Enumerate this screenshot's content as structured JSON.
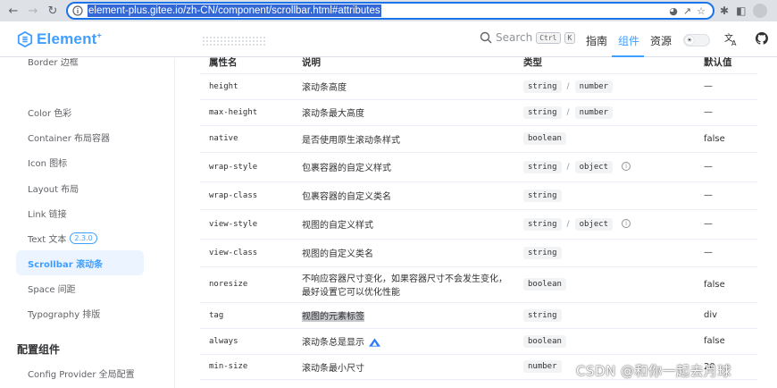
{
  "browser": {
    "url": "element-plus.gitee.io/zh-CN/component/scrollbar.html#attributes"
  },
  "header": {
    "logo_text": "Element",
    "logo_sup": "+",
    "search_label": "Search",
    "search_keys": [
      "Ctrl",
      "K"
    ],
    "nav": [
      "指南",
      "组件",
      "资源"
    ],
    "active_nav": "组件"
  },
  "sidebar": {
    "cut_item": "Border 边框",
    "items": [
      {
        "label": "Color 色彩"
      },
      {
        "label": "Container 布局容器"
      },
      {
        "label": "Icon 图标"
      },
      {
        "label": "Layout 布局"
      },
      {
        "label": "Link 链接"
      },
      {
        "label": "Text 文本",
        "badge": "2.3.0"
      },
      {
        "label": "Scrollbar 滚动条",
        "active": true
      },
      {
        "label": "Space 间距"
      },
      {
        "label": "Typography 排版"
      }
    ],
    "group_title": "配置组件",
    "group_items": [
      {
        "label": "Config Provider 全局配置"
      }
    ]
  },
  "table": {
    "headers": [
      "属性名",
      "说明",
      "类型",
      "默认值"
    ],
    "rows": [
      {
        "name": "height",
        "desc": "滚动条高度",
        "types": [
          "string",
          "number"
        ],
        "info": false,
        "default": "—"
      },
      {
        "name": "max-height",
        "desc": "滚动条最大高度",
        "types": [
          "string",
          "number"
        ],
        "info": false,
        "default": "—"
      },
      {
        "name": "native",
        "desc": "是否使用原生滚动条样式",
        "types": [
          "boolean"
        ],
        "info": false,
        "default": "false"
      },
      {
        "name": "wrap-style",
        "desc": "包裹容器的自定义样式",
        "types": [
          "string",
          "object"
        ],
        "info": true,
        "default": "—"
      },
      {
        "name": "wrap-class",
        "desc": "包裹容器的自定义类名",
        "types": [
          "string"
        ],
        "info": false,
        "default": "—"
      },
      {
        "name": "view-style",
        "desc": "视图的自定义样式",
        "types": [
          "string",
          "object"
        ],
        "info": true,
        "default": "—"
      },
      {
        "name": "view-class",
        "desc": "视图的自定义类名",
        "types": [
          "string"
        ],
        "info": false,
        "default": "—"
      },
      {
        "name": "noresize",
        "desc": "不响应容器尺寸变化，如果容器尺寸不会发生变化，最好设置它可以优化性能",
        "types": [
          "boolean"
        ],
        "info": false,
        "default": "false"
      },
      {
        "name": "tag",
        "desc": "视图的元素标签",
        "types": [
          "string"
        ],
        "info": false,
        "default": "div",
        "highlight": true
      },
      {
        "name": "always",
        "desc": "滚动条总是显示",
        "types": [
          "boolean"
        ],
        "info": false,
        "default": "false",
        "deco": true
      },
      {
        "name": "min-size",
        "desc": "滚动条最小尺寸",
        "types": [
          "number"
        ],
        "info": false,
        "default": "20"
      }
    ]
  },
  "watermark": "CSDN @和你一起去月球",
  "colors": {
    "primary": "#409eff",
    "active_bg": "#ecf5ff",
    "url_highlight": "#3367d6"
  }
}
